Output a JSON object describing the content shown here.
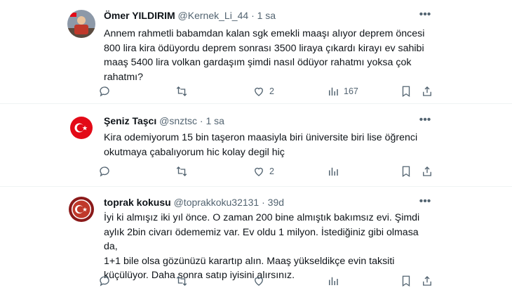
{
  "tweets": [
    {
      "name": "Ömer YILDIRIM",
      "handle": "@Kernek_Li_44",
      "time": "1 sa",
      "text_lines": [
        "Annem rahmetli babamdan kalan sgk emekli maaşı alıyor deprem öncesi",
        "800 lira kira ödüyordu deprem sonrası 3500 liraya çıkardı kirayı ev sahibi",
        "maaş 5400 lira   volkan gardaşım şimdi nasıl ödüyor rahatmı yoksa çok",
        "rahatmı?"
      ],
      "counts": {
        "reply": "",
        "retweet": "",
        "like": "2",
        "views": "167"
      }
    },
    {
      "name": "Şeniz Taşcı",
      "handle": "@snztsc",
      "time": "1 sa",
      "text_lines": [
        "Kira odemiyorum 15 bin taşeron maasiyla biri üniversite biri lise öğrenci",
        "okutmaya çabalıyorum hic kolay degil hiç"
      ],
      "counts": {
        "reply": "",
        "retweet": "",
        "like": "2",
        "views": ""
      }
    },
    {
      "name": "toprak kokusu",
      "handle": "@toprakkoku32131",
      "time": "39d",
      "text_lines": [
        "İyi ki almışız iki yıl önce. O zaman 200 bine almıştık bakımsız evi. Şimdi",
        "aylık 2bin civarı ödememiz var. Ev oldu 1 milyon. İstediğiniz gibi olmasa da,",
        "1+1 bile olsa gözünüzü karartıp alın. Maaş yükseldikçe evin taksiti",
        "küçülüyor. Daha sonra satıp iyisini alırsınız."
      ],
      "counts": {
        "reply": "",
        "retweet": "",
        "like": "",
        "views": ""
      }
    }
  ],
  "separator": "·",
  "icons": [
    "reply-icon",
    "retweet-icon",
    "like-icon",
    "views-icon",
    "bookmark-icon",
    "share-icon",
    "more-icon"
  ],
  "colors": {
    "text": "#0f1419",
    "secondary": "#536471",
    "border": "#eff3f4",
    "flag_red": "#e30a17"
  }
}
